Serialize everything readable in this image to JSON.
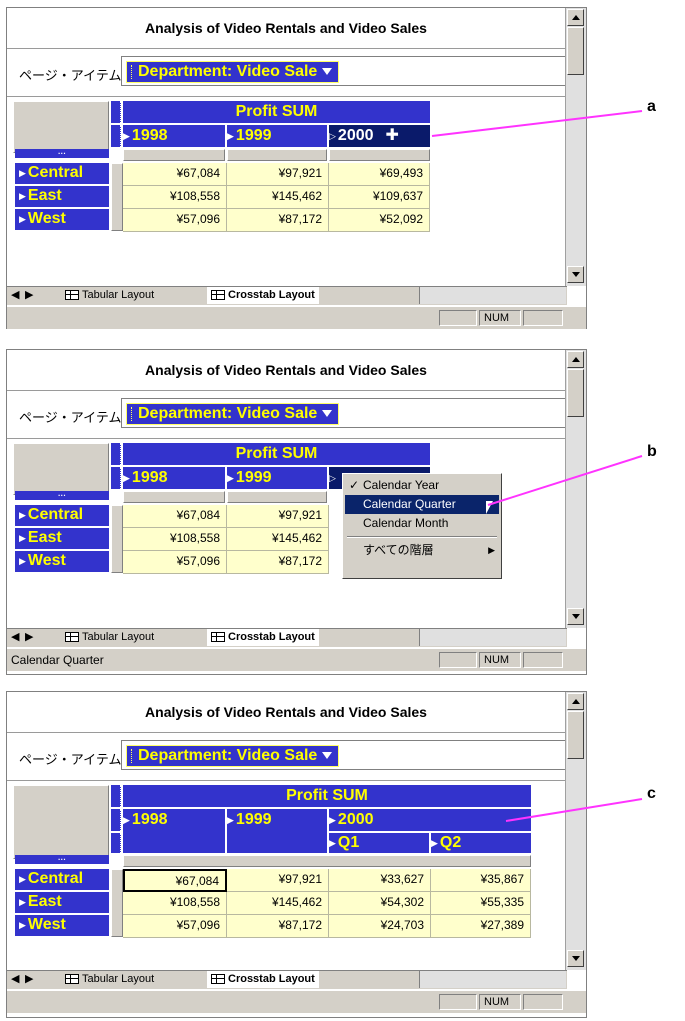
{
  "common": {
    "title": "Analysis of Video Rentals and Video Sales",
    "page_item_label": "ページ・アイテム:",
    "page_item_value": "Department: Video Sale",
    "measure": "Profit SUM",
    "tabs": [
      "Tabular Layout",
      "Crosstab Layout"
    ],
    "num": "NUM",
    "ellipsis": "···"
  },
  "panel_a": {
    "years": [
      "1998",
      "1999",
      "2000"
    ],
    "rows": [
      {
        "label": "Central",
        "values": [
          "¥67,084",
          "¥97,921",
          "¥69,493"
        ]
      },
      {
        "label": "East",
        "values": [
          "¥108,558",
          "¥145,462",
          "¥109,637"
        ]
      },
      {
        "label": "West",
        "values": [
          "¥57,096",
          "¥87,172",
          "¥52,092"
        ]
      }
    ],
    "plus": "✚",
    "status": ""
  },
  "panel_b": {
    "years": [
      "1998",
      "1999"
    ],
    "rows": [
      {
        "label": "Central",
        "values": [
          "¥67,084",
          "¥97,921"
        ]
      },
      {
        "label": "East",
        "values": [
          "¥108,558",
          "¥145,462"
        ]
      },
      {
        "label": "West",
        "values": [
          "¥57,096",
          "¥87,172"
        ]
      }
    ],
    "menu": {
      "items": [
        "Calendar Year",
        "Calendar Quarter",
        "Calendar Month"
      ],
      "checked": "✓",
      "extra": "すべての階層",
      "submenu_arrow": "▶"
    },
    "status": "Calendar Quarter"
  },
  "panel_c": {
    "years": [
      "1998",
      "1999",
      "2000"
    ],
    "quarters": [
      "Q1",
      "Q2"
    ],
    "rows": [
      {
        "label": "Central",
        "values": [
          "¥67,084",
          "¥97,921",
          "¥33,627",
          "¥35,867"
        ]
      },
      {
        "label": "East",
        "values": [
          "¥108,558",
          "¥145,462",
          "¥54,302",
          "¥55,335"
        ]
      },
      {
        "label": "West",
        "values": [
          "¥57,096",
          "¥87,172",
          "¥24,703",
          "¥27,389"
        ]
      }
    ],
    "status": ""
  },
  "callouts": {
    "a": "a",
    "b": "b",
    "c": "c"
  },
  "colors": {
    "header_blue": "#3333cc",
    "label_yellow": "#ffff00",
    "data_bg": "#ffffcc",
    "callout_line": "#ff33ff",
    "menu_highlight": "#0a246a"
  }
}
